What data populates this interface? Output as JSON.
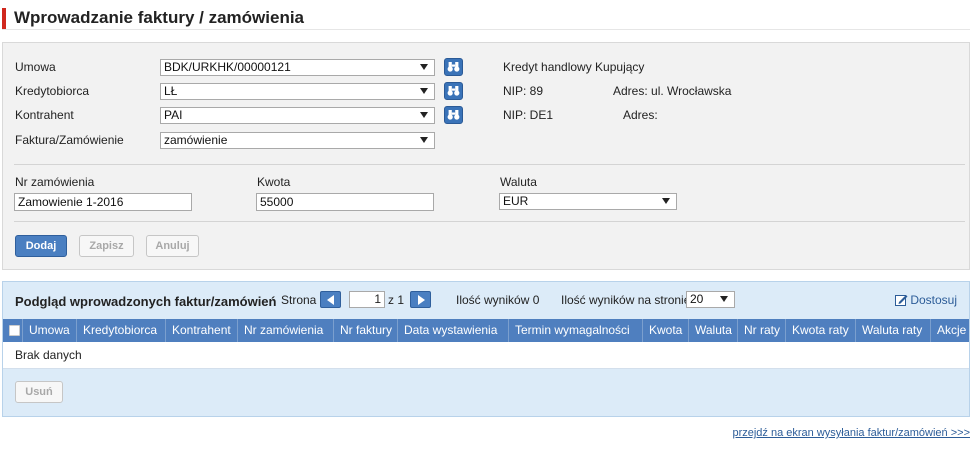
{
  "page": {
    "title": "Wprowadzanie faktury / zamówienia"
  },
  "form": {
    "umowa": {
      "label": "Umowa",
      "value": "BDK/URKHK/00000121"
    },
    "kredytobiorca": {
      "label": "Kredytobiorca",
      "value": "LŁ"
    },
    "kontrahent": {
      "label": "Kontrahent",
      "value": "PAI"
    },
    "typ": {
      "label": "Faktura/Zamówienie",
      "value": "zamówienie"
    },
    "info": {
      "kredyt": "Kredyt handlowy Kupujący",
      "nip1": "NIP: 89",
      "adres1": "Adres: ul. Wrocławska",
      "nip2": "NIP: DE1",
      "adres2": "Adres:"
    },
    "nr_zamowienia": {
      "label": "Nr zamówienia",
      "value": "Zamowienie 1-2016"
    },
    "kwota": {
      "label": "Kwota",
      "value": "55000"
    },
    "waluta": {
      "label": "Waluta",
      "value": "EUR"
    },
    "buttons": {
      "add": "Dodaj",
      "save": "Zapisz",
      "cancel": "Anuluj"
    }
  },
  "results": {
    "title": "Podgląd wprowadzonych faktur/zamówień",
    "page_label": "Strona",
    "page_value": "1",
    "page_of": "z 1",
    "count_label": "Ilość wyników 0",
    "per_page_label": "Ilość wyników na stronie",
    "per_page_value": "20",
    "adjust": "Dostosuj",
    "columns": [
      "Umowa",
      "Kredytobiorca",
      "Kontrahent",
      "Nr zamówienia",
      "Nr faktury",
      "Data wystawienia",
      "Termin wymagalności",
      "Kwota",
      "Waluta",
      "Nr raty",
      "Kwota raty",
      "Waluta raty",
      "Akcje"
    ],
    "empty": "Brak danych",
    "delete": "Usuń"
  },
  "footer": {
    "link": "przejdź na ekran wysyłania faktur/zamówień >>>"
  },
  "colors": {
    "accent": "#d0271d",
    "primary": "#4a7fc1",
    "header": "#4f7fbf",
    "panel": "#dcebf8"
  }
}
